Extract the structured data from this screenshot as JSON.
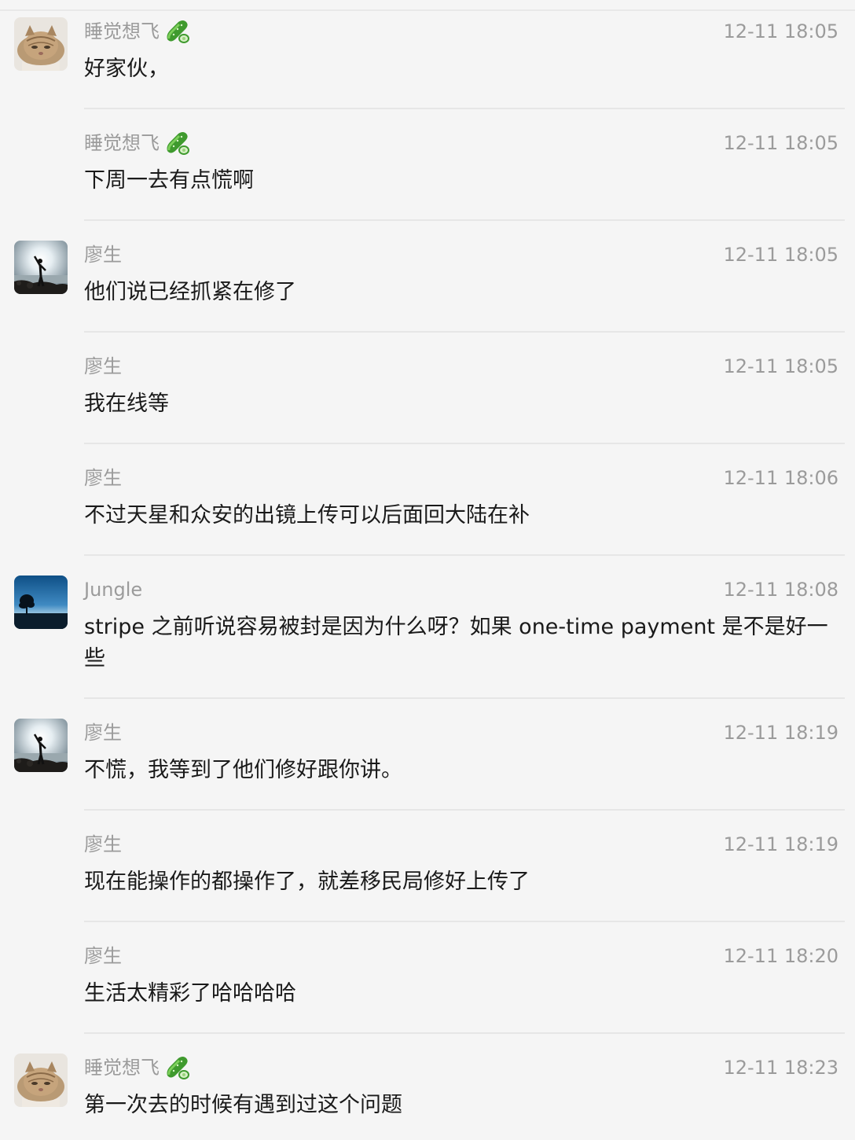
{
  "messages": [
    {
      "sender": "睡觉想飞",
      "badge": "cucumber-icon",
      "avatar": "cat-avatar",
      "time": "12-11 18:05",
      "text": "好家伙，"
    },
    {
      "sender": "睡觉想飞",
      "badge": "cucumber-icon",
      "avatar": "",
      "time": "12-11 18:05",
      "text": "下周一去有点慌啊"
    },
    {
      "sender": "廖生",
      "badge": "",
      "avatar": "silhouette-avatar",
      "time": "12-11 18:05",
      "text": "他们说已经抓紧在修了"
    },
    {
      "sender": "廖生",
      "badge": "",
      "avatar": "",
      "time": "12-11 18:05",
      "text": "我在线等"
    },
    {
      "sender": "廖生",
      "badge": "",
      "avatar": "",
      "time": "12-11 18:06",
      "text": "不过天星和众安的出镜上传可以后面回大陆在补"
    },
    {
      "sender": "Jungle",
      "badge": "",
      "avatar": "tree-sky-avatar",
      "time": "12-11 18:08",
      "text": "stripe 之前听说容易被封是因为什么呀？如果 one-time payment 是不是好一些"
    },
    {
      "sender": "廖生",
      "badge": "",
      "avatar": "silhouette-avatar",
      "time": "12-11 18:19",
      "text": "不慌，我等到了他们修好跟你讲。"
    },
    {
      "sender": "廖生",
      "badge": "",
      "avatar": "",
      "time": "12-11 18:19",
      "text": "现在能操作的都操作了，就差移民局修好上传了"
    },
    {
      "sender": "廖生",
      "badge": "",
      "avatar": "",
      "time": "12-11 18:20",
      "text": "生活太精彩了哈哈哈哈"
    },
    {
      "sender": "睡觉想飞",
      "badge": "cucumber-icon",
      "avatar": "cat-avatar",
      "time": "12-11 18:23",
      "text": "第一次去的时候有遇到过这个问题"
    }
  ],
  "colors": {
    "background": "#f5f5f5",
    "meta_text": "#9b9b9b",
    "body_text": "#1a1a1a",
    "divider": "#e6e6e6"
  }
}
